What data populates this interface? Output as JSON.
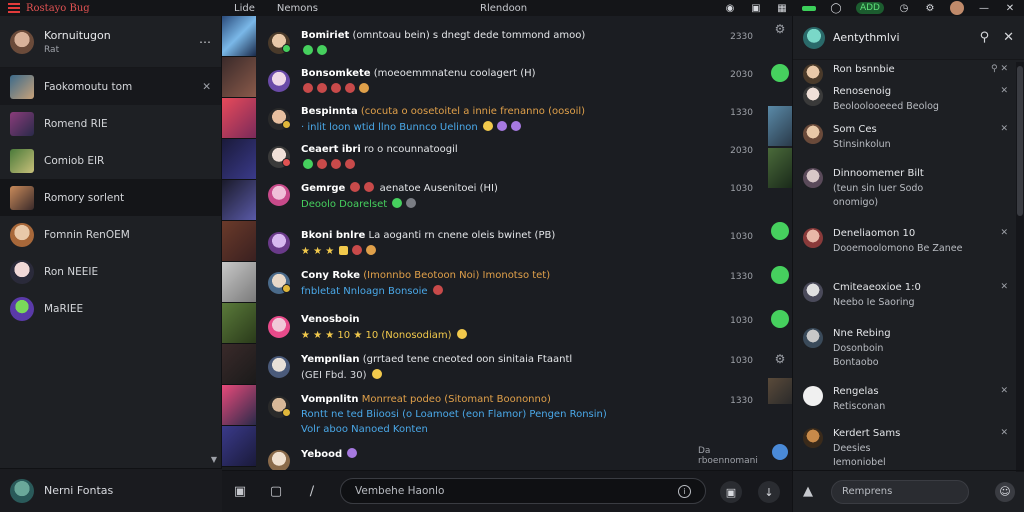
{
  "topbar": {
    "brand": "Rostayo Bug",
    "menu": [
      "Lide",
      "Nemons"
    ],
    "title": "Rlendoon",
    "pill_label": "ADD"
  },
  "sidebar": {
    "header_title": "Kornuitugon",
    "header_sub": "Rat",
    "conversations": [
      {
        "label": "Faokomoutu tom"
      },
      {
        "label": "Romend RIE"
      },
      {
        "label": "Comiob EIR"
      },
      {
        "label": "Romory sorlent"
      },
      {
        "label": "Fomnin RenOEM"
      },
      {
        "label": "Ron NEEIE"
      },
      {
        "label": "MaRIEE"
      }
    ],
    "footer_name": "Nerni Fontas"
  },
  "chat": {
    "messages": [
      {
        "name": "Bomiriet",
        "text": "(omntoau bein) s dnegt dede tommond amoo)",
        "sub": "",
        "time": "2330"
      },
      {
        "name": "Bonsomkete",
        "text": "(moeoemmnatenu coolagert (H)",
        "sub": "",
        "time": "2030"
      },
      {
        "name": "Bespinnta",
        "text": "(cocuta o oosetoitel a innie frenanno (oosoil)",
        "sub": "· inlit loon wtid llno Bunnco Uelinon",
        "time": "1330"
      },
      {
        "name": "Ceaert ibri",
        "text": "ro o ncounnatoogil",
        "sub": "",
        "time": "2030"
      },
      {
        "name": "Gemrge",
        "text": "aenatoe Ausenitoei (HI)",
        "sub": "Deoolo Doarelset",
        "time": "1030"
      },
      {
        "name": "Bkoni bnlre",
        "text": "La aoganti rn cnene oleis bwinet (PB)",
        "sub": "★ ★ ★",
        "time": "1030"
      },
      {
        "name": "Cony Roke",
        "text": "(Imonnbo Beotoon Noi) Imonotso tet)",
        "sub": "fnbletat  Nnloagn  Bonsoie",
        "time": "1330"
      },
      {
        "name": "Venosboin",
        "text": "",
        "sub": "★ ★ ★  10  ★ 10  (Nonosodiam)",
        "time": "1030"
      },
      {
        "name": "Yempnlian",
        "text": "(grrtaed tene cneoted oon sinitaia Ftaantl",
        "sub": "(GEI Fbd. 30)",
        "time": "1030"
      },
      {
        "name": "Vompnlitn",
        "text": "Monrreat podeo (Sitomant Boononno)",
        "sub": "Rontt ne ted Biioosi (o Loamoet  (eon Flamor)  Pengen  Ronsin)",
        "sub2": "Volr aboo  Nanoed  Konten",
        "time": "1330"
      },
      {
        "name": "Yebood",
        "text": "",
        "sub": "",
        "time": ""
      }
    ],
    "typing_text": "Da rboennomani"
  },
  "composer": {
    "placeholder": "Vembehe Haonlo"
  },
  "rpanel": {
    "title": "Aentythmlvi",
    "items": [
      {
        "title": "Ron bsnnbie",
        "sub": ""
      },
      {
        "title": "Renosenoig",
        "sub": "Beoloolooeeed  Beolog"
      },
      {
        "title": "Som Ces",
        "sub": "Stinsinkolun"
      },
      {
        "title": "Dinnoomemer Bilt",
        "sub": "(teun sin Iuer Sodo",
        "sub2": "onomigo)"
      },
      {
        "title": "Deneliaomon 10",
        "sub": "Dooemoolomono  Be  Zanee"
      },
      {
        "title": "Cmiteaeoxioe 1:0",
        "sub": "Neebo Ie Saoring"
      },
      {
        "title": "Nne Rebing",
        "sub": "Dosonboin",
        "sub2": "Bontaobo"
      },
      {
        "title": "Rengelas",
        "sub": "Retisconan"
      },
      {
        "title": "Kerdert Sams",
        "sub": "Deesies",
        "sub2": "Iemoniobel"
      }
    ],
    "input_placeholder": "Remprens"
  },
  "colors": {
    "accent_green": "#46d05e",
    "accent_orange": "#e0a04a",
    "accent_blue": "#4aa8e8",
    "brand_red": "#e05252"
  }
}
